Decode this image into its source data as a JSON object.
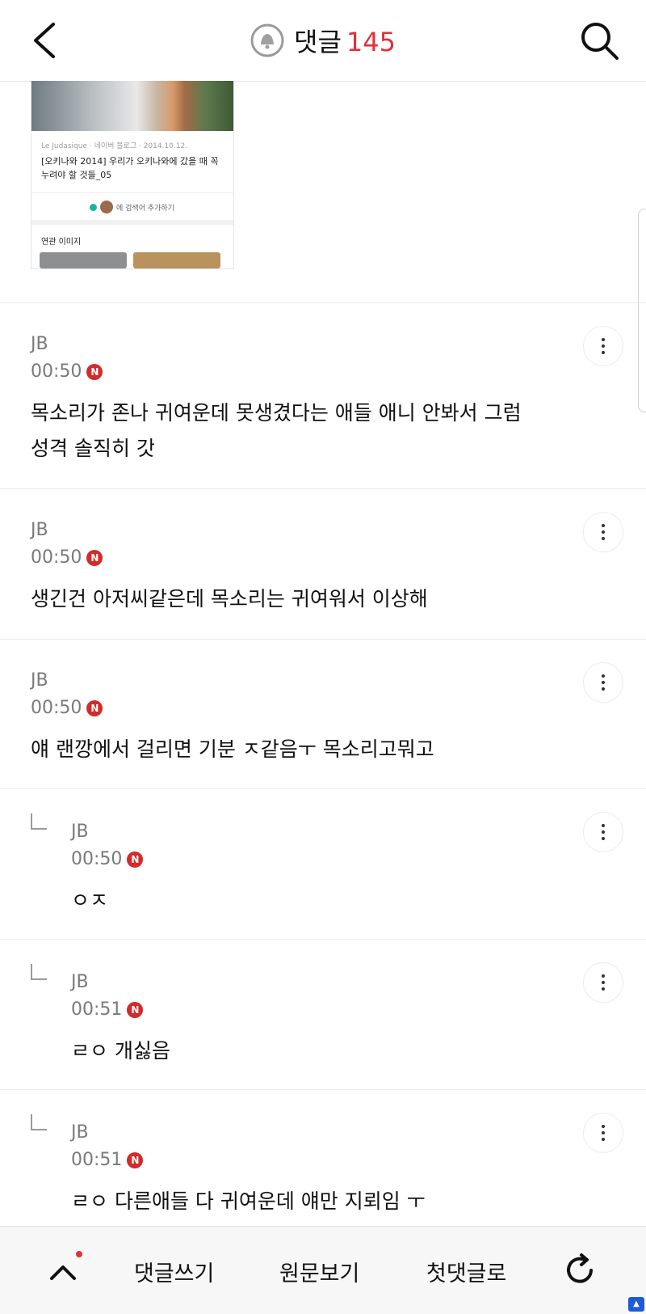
{
  "header": {
    "title": "댓글",
    "count": "145"
  },
  "attachment": {
    "blog_line": "Le Judasique · 네이버 블로그 · 2014.10.12.",
    "blog_title": "[오키나와 2014] 우리가 오키나와에 갔을 때 꼭 누려야 할 것들_05",
    "search_add": "에 검색어 추가하기",
    "related_label": "연관 이미지"
  },
  "comments": [
    {
      "author": "JB",
      "time": "00:50",
      "badge": "N",
      "lines": [
        "목소리가 존나 귀여운데 못생겼다는 애들 애니 안봐서 그럼",
        "성격 솔직히 갓"
      ]
    },
    {
      "author": "JB",
      "time": "00:50",
      "badge": "N",
      "lines": [
        "생긴건 아저씨같은데 목소리는 귀여워서 이상해"
      ]
    },
    {
      "author": "JB",
      "time": "00:50",
      "badge": "N",
      "lines": [
        "얘 랜깡에서 걸리면 기분 ㅈ같음ㅜ 목소리고뭐고"
      ]
    },
    {
      "author": "JB",
      "time": "00:50",
      "badge": "N",
      "lines": [
        "ㅇㅈ"
      ]
    },
    {
      "author": "JB",
      "time": "00:51",
      "badge": "N",
      "lines": [
        "ㄹㅇ 개싫음"
      ]
    },
    {
      "author": "JB",
      "time": "00:51",
      "badge": "N",
      "lines": [
        "ㄹㅇ 다른애들 다 귀여운데 얘만 지뢰임 ㅜ"
      ]
    }
  ],
  "bottom_bar": {
    "write": "댓글쓰기",
    "original": "원문보기",
    "first": "첫댓글로"
  }
}
